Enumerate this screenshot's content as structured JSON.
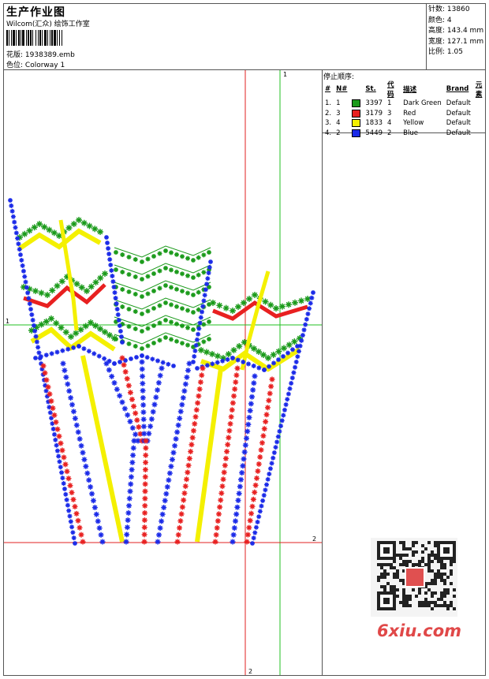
{
  "header": {
    "title": "生产作业图",
    "subtitle": "Wilcom(汇众) 绘饰工作室",
    "design_label": "花版:",
    "design_value": "1938389.emb",
    "colorway_label": "色位:",
    "colorway_value": "Colorway 1"
  },
  "stats": [
    {
      "label": "针数:",
      "value": "13860"
    },
    {
      "label": "颜色:",
      "value": "4"
    },
    {
      "label": "高度:",
      "value": "143.4 mm"
    },
    {
      "label": "宽度:",
      "value": "127.1 mm"
    },
    {
      "label": "比例:",
      "value": "1.05"
    }
  ],
  "stop_sequence": {
    "title": "停止顺序:",
    "columns": [
      "#",
      "N#",
      "St.",
      "代码",
      "描述",
      "Brand",
      "元素"
    ],
    "rows": [
      {
        "idx": "1.",
        "n": "1",
        "color": "#1a9a1a",
        "st": "3397",
        "code": "1",
        "desc": "Dark Green",
        "brand": "Default"
      },
      {
        "idx": "2.",
        "n": "3",
        "color": "#e82020",
        "st": "3179",
        "code": "3",
        "desc": "Red",
        "brand": "Default"
      },
      {
        "idx": "3.",
        "n": "4",
        "color": "#f4f000",
        "st": "1833",
        "code": "4",
        "desc": "Yellow",
        "brand": "Default"
      },
      {
        "idx": "4.",
        "n": "2",
        "color": "#1a2ae8",
        "st": "5449",
        "code": "2",
        "desc": "Blue",
        "brand": "Default"
      }
    ]
  },
  "axes": {
    "v_green_label": "1",
    "h_green_label": "1",
    "h_red_label": "2",
    "v_red_label": "2"
  },
  "colors": {
    "dark_green": "#1a9a1a",
    "red": "#e82020",
    "yellow": "#f4f000",
    "blue": "#1a2ae8",
    "axis_red": "#e02020",
    "axis_green": "#20c020"
  },
  "watermark": {
    "text": "6xiu.com",
    "qr_stamp": "印印\n印印"
  }
}
